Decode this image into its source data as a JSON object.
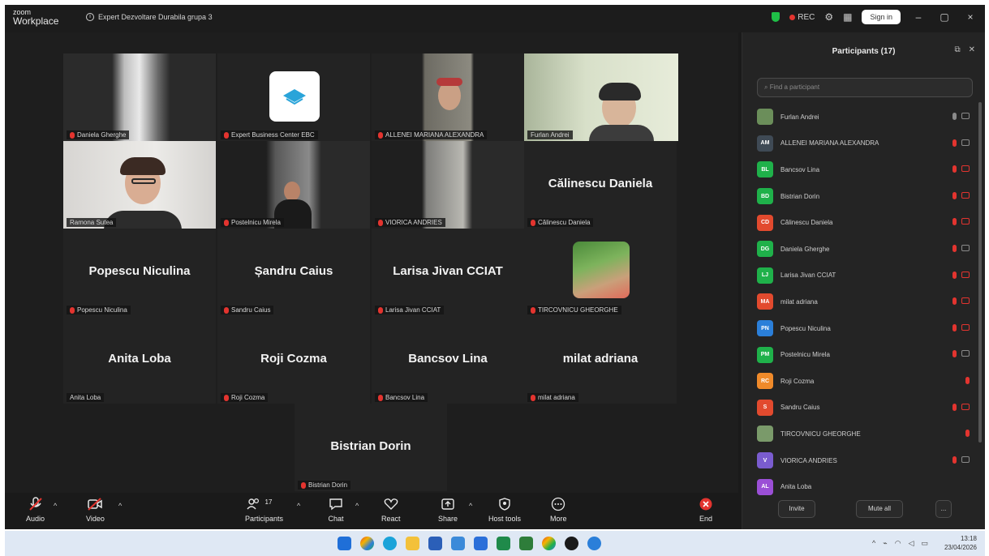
{
  "window": {
    "brand_top": "zoom",
    "brand_bottom": "Workplace",
    "meeting_title": "Expert Dezvoltare Durabila grupa 3",
    "rec_label": "REC",
    "signin_label": "Sign in"
  },
  "tiles": [
    {
      "name": "Daniela Gherghe",
      "big": ""
    },
    {
      "name": "Expert Business Center EBC",
      "big": ""
    },
    {
      "name": "ALLENEI MARIANA ALEXANDRA",
      "big": ""
    },
    {
      "name": "Furlan Andrei",
      "big": ""
    },
    {
      "name": "Ramona Sutea",
      "big": ""
    },
    {
      "name": "Postelnicu Mirela",
      "big": ""
    },
    {
      "name": "VIORICA ANDRIES",
      "big": ""
    },
    {
      "name": "Călinescu Daniela",
      "big": "Călinescu Daniela"
    },
    {
      "name": "Popescu Niculina",
      "big": "Popescu Niculina"
    },
    {
      "name": "Sandru Caius",
      "big": "Șandru Caius"
    },
    {
      "name": "Larisa Jivan CCIAT",
      "big": "Larisa Jivan CCIAT"
    },
    {
      "name": "TIRCOVNICU GHEORGHE",
      "big": ""
    },
    {
      "name": "Anita Loba",
      "big": "Anita Loba"
    },
    {
      "name": "Roji Cozma",
      "big": "Roji Cozma"
    },
    {
      "name": "Bancsov Lina",
      "big": "Bancsov Lina"
    },
    {
      "name": "milat adriana",
      "big": "milat adriana"
    },
    {
      "name": "Bistrian Dorin",
      "big": "Bistrian Dorin"
    }
  ],
  "toolbar": {
    "audio": "Audio",
    "video": "Video",
    "participants": "Participants",
    "participants_count": "17",
    "chat": "Chat",
    "react": "React",
    "share": "Share",
    "host_tools": "Host tools",
    "more": "More",
    "end": "End"
  },
  "panel": {
    "title": "Participants (17)",
    "search_placeholder": "Find a participant",
    "invite": "Invite",
    "mute_all": "Mute all",
    "more": "..."
  },
  "participants": [
    {
      "initials": "",
      "name": "Furlan Andrei",
      "color": "#6b8e5a",
      "mic": "on",
      "cam": "on"
    },
    {
      "initials": "AM",
      "name": "ALLENEI MARIANA ALEXANDRA",
      "color": "#3f4a55",
      "mic": "off",
      "cam": "on"
    },
    {
      "initials": "BL",
      "name": "Bancsov Lina",
      "color": "#1fb14a",
      "mic": "off",
      "cam": "off"
    },
    {
      "initials": "BD",
      "name": "Bistrian Dorin",
      "color": "#1fb14a",
      "mic": "off",
      "cam": "off"
    },
    {
      "initials": "CD",
      "name": "Călinescu Daniela",
      "color": "#e24a2e",
      "mic": "off",
      "cam": "off"
    },
    {
      "initials": "DG",
      "name": "Daniela Gherghe",
      "color": "#1fb14a",
      "mic": "off",
      "cam": "on"
    },
    {
      "initials": "LJ",
      "name": "Larisa Jivan CCIAT",
      "color": "#1fb14a",
      "mic": "off",
      "cam": "off"
    },
    {
      "initials": "MA",
      "name": "milat adriana",
      "color": "#e24a2e",
      "mic": "off",
      "cam": "off"
    },
    {
      "initials": "PN",
      "name": "Popescu Niculina",
      "color": "#2b7fd9",
      "mic": "off",
      "cam": "off"
    },
    {
      "initials": "PM",
      "name": "Postelnicu Mirela",
      "color": "#1fb14a",
      "mic": "off",
      "cam": "on"
    },
    {
      "initials": "RC",
      "name": "Roji Cozma",
      "color": "#f08a2a",
      "mic": "off",
      "cam": ""
    },
    {
      "initials": "S",
      "name": "Sandru Caius",
      "color": "#e24a2e",
      "mic": "off",
      "cam": "off"
    },
    {
      "initials": "",
      "name": "TIRCOVNICU GHEORGHE",
      "color": "#7a9a6a",
      "mic": "off",
      "cam": ""
    },
    {
      "initials": "V",
      "name": "VIORICA ANDRIES",
      "color": "#7a5ccf",
      "mic": "off",
      "cam": "on"
    },
    {
      "initials": "AL",
      "name": "Anita Loba",
      "color": "#9b4fd6",
      "mic": "",
      "cam": ""
    }
  ],
  "taskbar": {
    "time": "13:18",
    "date": "23/04/2026"
  }
}
